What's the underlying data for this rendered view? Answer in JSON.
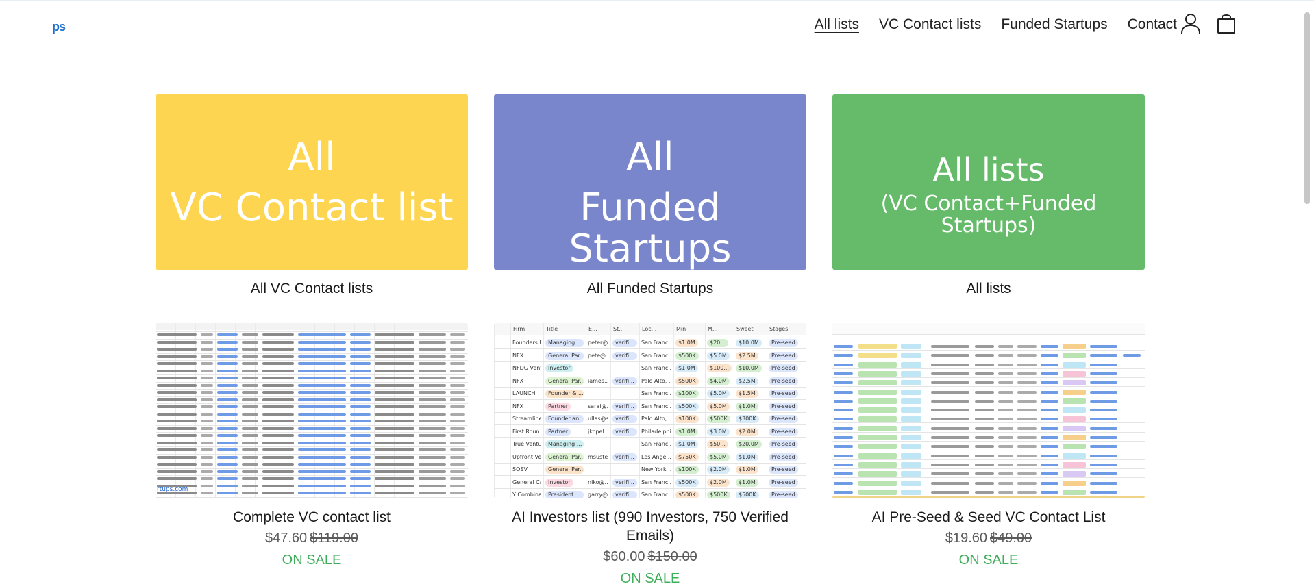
{
  "header": {
    "logo_text": "ps",
    "nav": [
      {
        "label": "All lists",
        "active": true
      },
      {
        "label": "VC Contact lists",
        "active": false
      },
      {
        "label": "Funded Startups",
        "active": false
      },
      {
        "label": "Contact",
        "active": false
      }
    ],
    "icons": [
      "account-icon",
      "cart-icon"
    ]
  },
  "collections": [
    {
      "banner_line1": "All",
      "banner_line2": "VC Contact list",
      "banner_color": "#fed551",
      "title": "All VC Contact lists"
    },
    {
      "banner_line1": "All",
      "banner_line2": "Funded Startups",
      "banner_color": "#7986cb",
      "title": "All Funded Startups"
    },
    {
      "banner_line1": "All lists",
      "banner_line2": "(VC Contact+Funded Startups)",
      "banner_color": "#66bb6a",
      "title": "All lists"
    }
  ],
  "products": [
    {
      "title": "Complete VC contact list",
      "price": "$47.60",
      "compare_price": "$119.00",
      "badge": "ON SALE",
      "sheet_footer": "rtups.com"
    },
    {
      "title": "AI Investors list (990 Investors, 750 Verified Emails)",
      "price": "$60.00",
      "compare_price": "$150.00",
      "badge": "ON SALE",
      "sheet_headers": [
        "Firm",
        "Title",
        "E...",
        "St...",
        "Loc...",
        "Min",
        "M...",
        "Sweet",
        "Stages"
      ],
      "sheet_rows": [
        [
          "Founders F...",
          "Managing ...",
          "peter@...",
          "verifi...",
          "San Franci...",
          "$1.0M",
          "$20...",
          "$10.0M",
          "Pre-seed"
        ],
        [
          "NFX",
          "General Par...",
          "pete@...",
          "verifi...",
          "San Franci...",
          "$500K",
          "$5.0M",
          "$2.5M",
          "Pre-seed"
        ],
        [
          "NFDG Vent...",
          "Investor",
          "",
          "",
          "San Franci...",
          "$1.0M",
          "$100...",
          "$10.0M",
          "Pre-seed"
        ],
        [
          "NFX",
          "General Par...",
          "james...",
          "verifi...",
          "Palo Alto, ...",
          "$500K",
          "$4.0M",
          "$2.5M",
          "Pre-seed"
        ],
        [
          "LAUNCH",
          "Founder & ...",
          "",
          "",
          "San Franci...",
          "$100K",
          "$5.0M",
          "$1.5M",
          "Pre-seed"
        ],
        [
          "NFX",
          "Partner",
          "sarai@...",
          "verifi...",
          "San Franci...",
          "$500K",
          "$5.0M",
          "$1.0M",
          "Pre-seed"
        ],
        [
          "Streamline...",
          "Founder an...",
          "ullas@s...",
          "verifi...",
          "Palo Alto, ...",
          "$100K",
          "$500K",
          "$300K",
          "Pre-seed"
        ],
        [
          "First Roun...",
          "Partner",
          "jkopel...",
          "verifi...",
          "Philadelphi...",
          "$1.0M",
          "$3.0M",
          "$2.0M",
          "Pre-seed"
        ],
        [
          "True Ventu...",
          "Managing ...",
          "",
          "",
          "San Franci...",
          "$1.0M",
          "$50...",
          "$20.0M",
          "Pre-seed"
        ],
        [
          "Upfront Ve...",
          "General Par...",
          "msuste...",
          "verifi...",
          "Los Angel...",
          "$750K",
          "$5.0M",
          "$1.0M",
          "Pre-seed"
        ],
        [
          "SOSV",
          "General Par...",
          "",
          "",
          "New York ...",
          "$100K",
          "$2.0M",
          "$1.0M",
          "Pre-seed"
        ],
        [
          "General Ca...",
          "Investor",
          "niko@...",
          "verifi...",
          "San Franci...",
          "$500K",
          "$2.0M",
          "$1.0M",
          "Pre-seed"
        ],
        [
          "Y Combina...",
          "President ...",
          "garry@...",
          "verifi...",
          "San Franci...",
          "$500K",
          "$500K",
          "$500K",
          "Pre-seed"
        ]
      ]
    },
    {
      "title": "AI Pre-Seed & Seed VC Contact List",
      "price": "$19.60",
      "compare_price": "$49.00",
      "badge": "ON SALE"
    }
  ]
}
